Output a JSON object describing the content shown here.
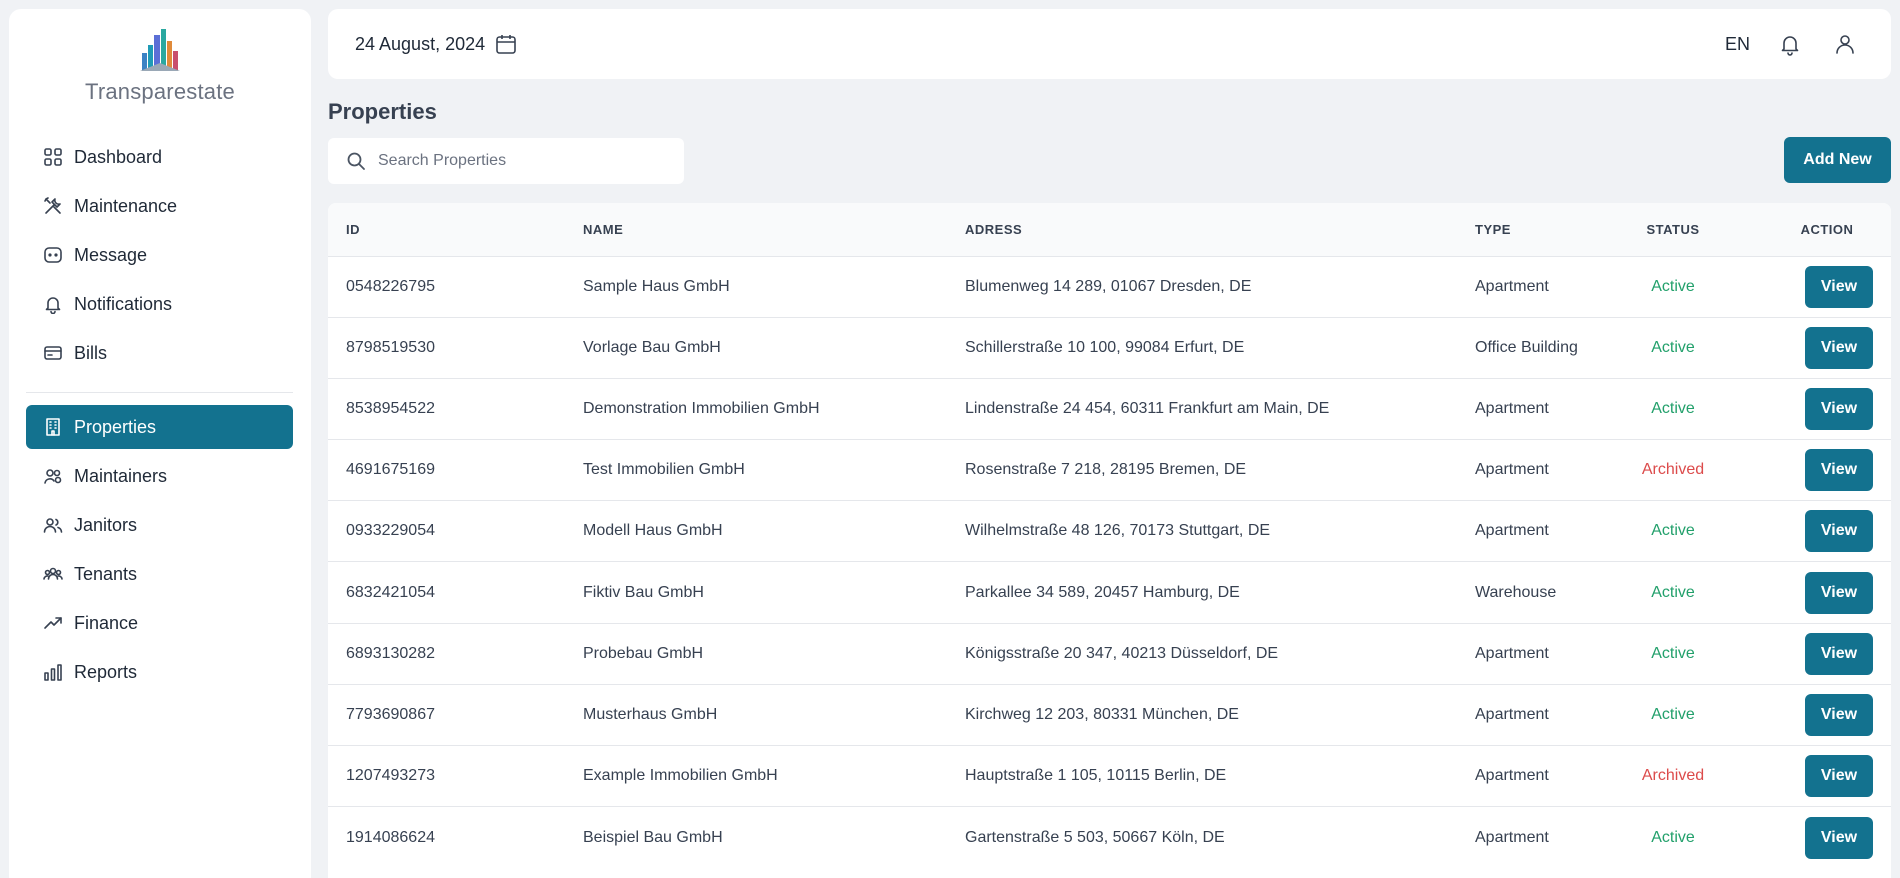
{
  "brand": {
    "name": "Transparestate",
    "logo_icon": "building-skyline-logo"
  },
  "sidebar": {
    "items": [
      {
        "label": "Dashboard",
        "icon": "grid-icon"
      },
      {
        "label": "Maintenance",
        "icon": "tools-icon"
      },
      {
        "label": "Message",
        "icon": "chat-icon"
      },
      {
        "label": "Notifications",
        "icon": "bell-icon"
      },
      {
        "label": "Bills",
        "icon": "credit-card-icon"
      },
      {
        "label": "Properties",
        "icon": "building-icon",
        "active": true
      },
      {
        "label": "Maintainers",
        "icon": "user-gear-icon"
      },
      {
        "label": "Janitors",
        "icon": "users-icon"
      },
      {
        "label": "Tenants",
        "icon": "group-icon"
      },
      {
        "label": "Finance",
        "icon": "trend-up-icon"
      },
      {
        "label": "Reports",
        "icon": "bar-chart-icon"
      }
    ]
  },
  "header": {
    "date": "24 August, 2024",
    "language": "EN"
  },
  "page": {
    "title": "Properties"
  },
  "search": {
    "placeholder": "Search Properties",
    "value": ""
  },
  "actions": {
    "add_new_label": "Add New"
  },
  "table": {
    "headers": {
      "id": "ID",
      "name": "NAME",
      "address": "ADRESS",
      "type": "TYPE",
      "status": "STATUS",
      "action": "ACTION"
    },
    "view_label": "View",
    "rows": [
      {
        "id": "0548226795",
        "name": "Sample Haus GmbH",
        "address": "Blumenweg 14 289, 01067 Dresden, DE",
        "type": "Apartment",
        "status": "Active"
      },
      {
        "id": "8798519530",
        "name": "Vorlage Bau GmbH",
        "address": "Schillerstraße 10 100, 99084 Erfurt, DE",
        "type": "Office Building",
        "status": "Active"
      },
      {
        "id": "8538954522",
        "name": "Demonstration Immobilien GmbH",
        "address": "Lindenstraße 24 454, 60311 Frankfurt am Main, DE",
        "type": "Apartment",
        "status": "Active"
      },
      {
        "id": "4691675169",
        "name": "Test Immobilien GmbH",
        "address": "Rosenstraße 7 218, 28195 Bremen, DE",
        "type": "Apartment",
        "status": "Archived"
      },
      {
        "id": "0933229054",
        "name": "Modell Haus GmbH",
        "address": "Wilhelmstraße 48 126, 70173 Stuttgart, DE",
        "type": "Apartment",
        "status": "Active"
      },
      {
        "id": "6832421054",
        "name": "Fiktiv Bau GmbH",
        "address": "Parkallee 34 589, 20457 Hamburg, DE",
        "type": "Warehouse",
        "status": "Active"
      },
      {
        "id": "6893130282",
        "name": "Probebau GmbH",
        "address": "Königsstraße 20 347, 40213 Düsseldorf, DE",
        "type": "Apartment",
        "status": "Active"
      },
      {
        "id": "7793690867",
        "name": "Musterhaus GmbH",
        "address": "Kirchweg 12 203, 80331 München, DE",
        "type": "Apartment",
        "status": "Active"
      },
      {
        "id": "1207493273",
        "name": "Example Immobilien GmbH",
        "address": "Hauptstraße 1 105, 10115 Berlin, DE",
        "type": "Apartment",
        "status": "Archived"
      },
      {
        "id": "1914086624",
        "name": "Beispiel Bau GmbH",
        "address": "Gartenstraße 5 503, 50667 Köln, DE",
        "type": "Apartment",
        "status": "Active"
      }
    ]
  },
  "colors": {
    "accent": "#13728f",
    "active": "#22a06b",
    "archived": "#dc4b4b"
  }
}
